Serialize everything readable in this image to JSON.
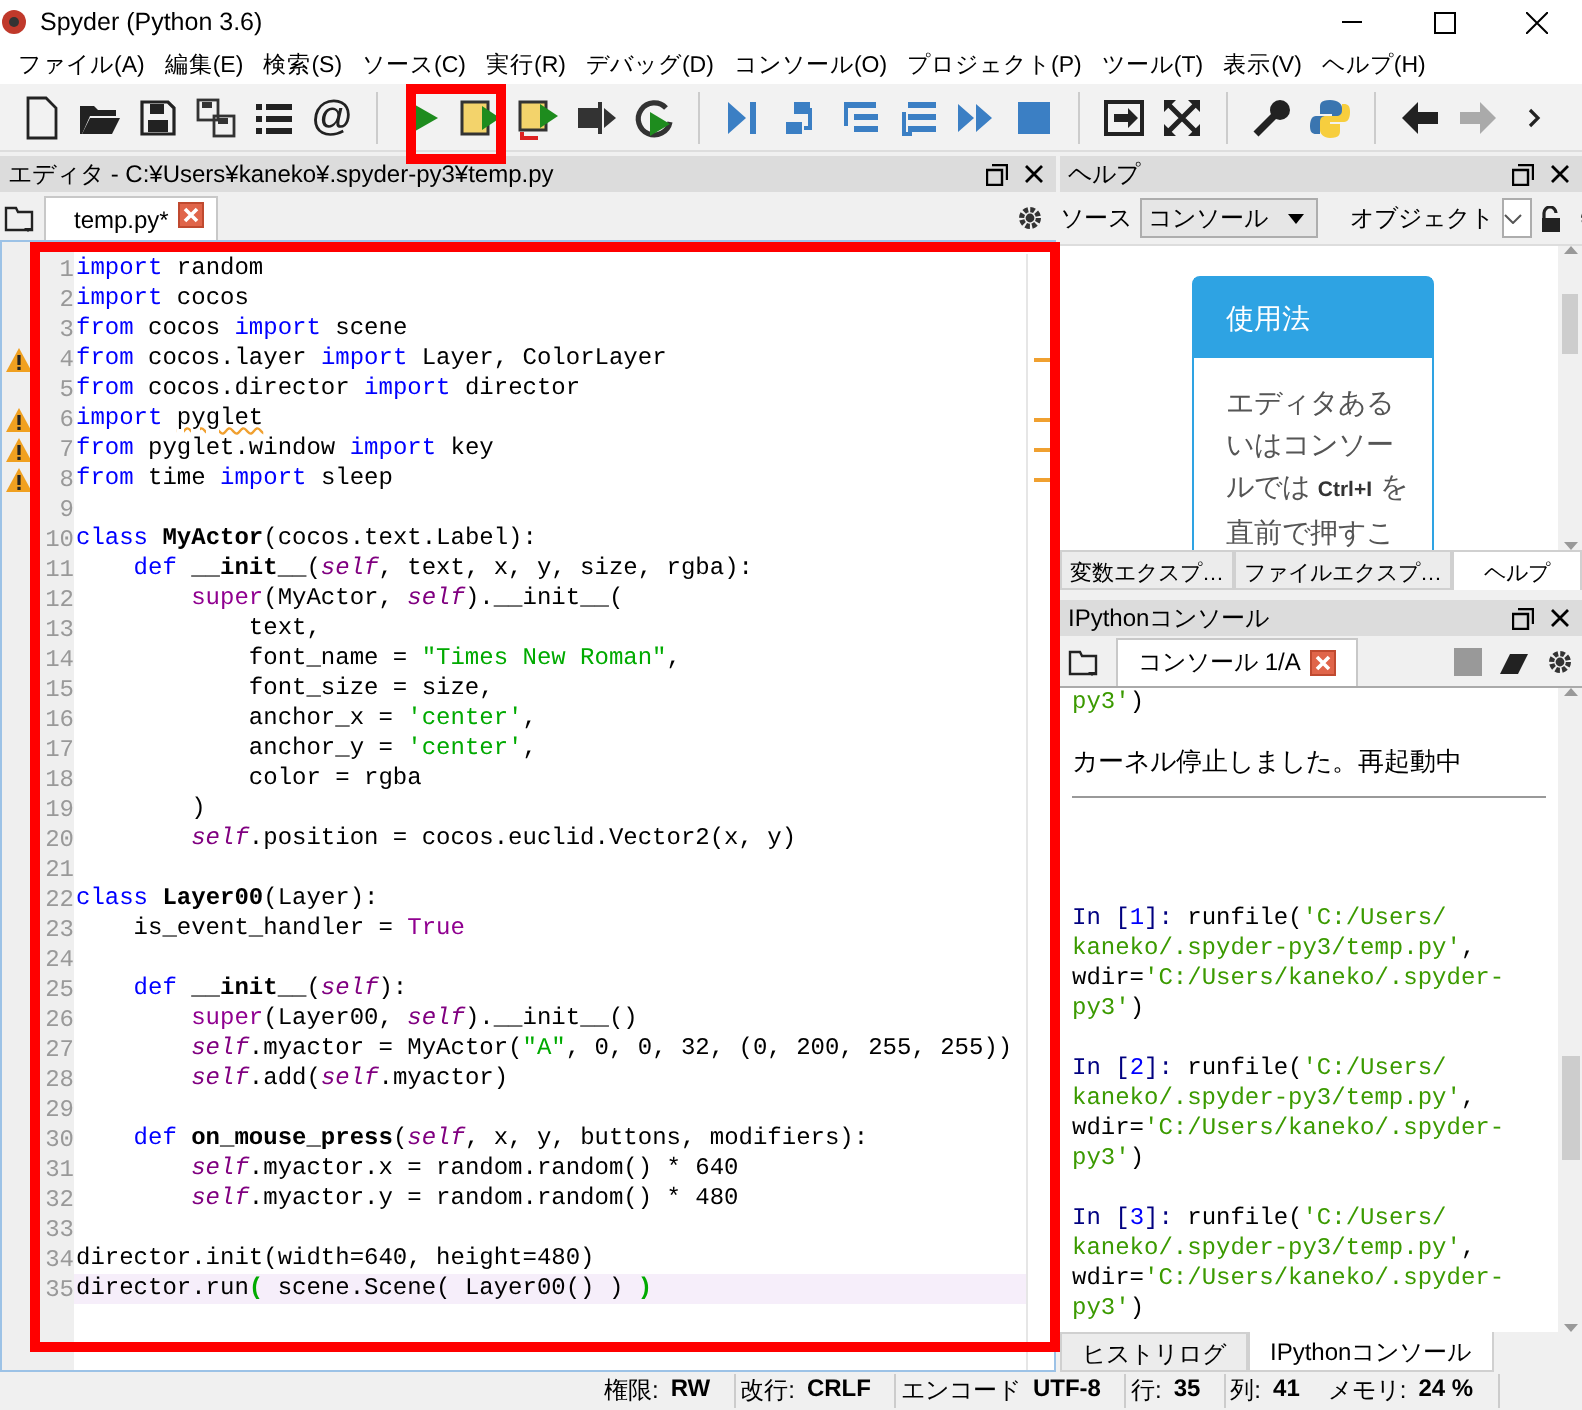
{
  "window": {
    "title": "Spyder (Python 3.6)"
  },
  "menu": [
    "ファイル(A)",
    "編集(E)",
    "検索(S)",
    "ソース(C)",
    "実行(R)",
    "デバッグ(D)",
    "コンソール(O)",
    "プロジェクト(P)",
    "ツール(T)",
    "表示(V)",
    "ヘルプ(H)"
  ],
  "toolbar": {
    "glyph": "@"
  },
  "editor": {
    "title": "エディタ - C:¥Users¥kaneko¥.spyder-py3¥temp.py",
    "tabs": [
      {
        "label": "temp.py*",
        "selected": true
      }
    ],
    "lines": [
      {
        "n": "1",
        "warning": false,
        "current": false,
        "tokens": [
          {
            "kind": "keyword",
            "text": "import "
          },
          {
            "kind": "plain",
            "text": "random"
          }
        ]
      },
      {
        "n": "2",
        "warning": false,
        "current": false,
        "tokens": [
          {
            "kind": "keyword",
            "text": "import "
          },
          {
            "kind": "plain",
            "text": "cocos"
          }
        ]
      },
      {
        "n": "3",
        "warning": false,
        "current": false,
        "tokens": [
          {
            "kind": "keyword",
            "text": "from "
          },
          {
            "kind": "plain",
            "text": "cocos "
          },
          {
            "kind": "keyword",
            "text": "import "
          },
          {
            "kind": "plain",
            "text": "scene"
          }
        ]
      },
      {
        "n": "4",
        "warning": true,
        "current": false,
        "tokens": [
          {
            "kind": "keyword",
            "text": "from "
          },
          {
            "kind": "plain",
            "text": "cocos.layer "
          },
          {
            "kind": "keyword",
            "text": "import "
          },
          {
            "kind": "plain",
            "text": "Layer, ColorLayer"
          }
        ]
      },
      {
        "n": "5",
        "warning": false,
        "current": false,
        "tokens": [
          {
            "kind": "keyword",
            "text": "from "
          },
          {
            "kind": "plain",
            "text": "cocos.director "
          },
          {
            "kind": "keyword",
            "text": "import "
          },
          {
            "kind": "plain",
            "text": "director"
          }
        ]
      },
      {
        "n": "6",
        "warning": true,
        "current": false,
        "tokens": [
          {
            "kind": "keyword",
            "text": "import "
          },
          {
            "kind": "warned",
            "text": "pyglet"
          }
        ]
      },
      {
        "n": "7",
        "warning": true,
        "current": false,
        "tokens": [
          {
            "kind": "keyword",
            "text": "from "
          },
          {
            "kind": "plain",
            "text": "pyglet.window "
          },
          {
            "kind": "keyword",
            "text": "import "
          },
          {
            "kind": "plain",
            "text": "key"
          }
        ]
      },
      {
        "n": "8",
        "warning": true,
        "current": false,
        "tokens": [
          {
            "kind": "keyword",
            "text": "from "
          },
          {
            "kind": "plain",
            "text": "time "
          },
          {
            "kind": "keyword",
            "text": "import "
          },
          {
            "kind": "plain",
            "text": "sleep"
          }
        ]
      },
      {
        "n": "9",
        "warning": false,
        "current": false
      },
      {
        "n": "10",
        "warning": false,
        "current": false,
        "tokens": [
          {
            "kind": "keyword",
            "text": "class "
          },
          {
            "kind": "definition",
            "text": "MyActor"
          },
          {
            "kind": "plain",
            "text": "(cocos.text.Label):"
          }
        ]
      },
      {
        "n": "11",
        "warning": false,
        "current": false,
        "tokens": [
          {
            "kind": "keyword",
            "text": "    def "
          },
          {
            "kind": "definition",
            "text": "__init__"
          },
          {
            "kind": "plain",
            "text": "("
          },
          {
            "kind": "self",
            "text": "self"
          },
          {
            "kind": "plain",
            "text": ", text, x, y, size, rgba):"
          }
        ]
      },
      {
        "n": "12",
        "warning": false,
        "current": false,
        "tokens": [
          {
            "kind": "builtin",
            "text": "        super"
          },
          {
            "kind": "plain",
            "text": "(MyActor, "
          },
          {
            "kind": "self",
            "text": "self"
          },
          {
            "kind": "plain",
            "text": ").__init__("
          }
        ]
      },
      {
        "n": "13",
        "warning": false,
        "current": false,
        "tokens": [
          {
            "kind": "plain",
            "text": "            text,"
          }
        ]
      },
      {
        "n": "14",
        "warning": false,
        "current": false,
        "tokens": [
          {
            "kind": "plain",
            "text": "            font_name = "
          },
          {
            "kind": "string",
            "text": "\"Times New Roman\""
          },
          {
            "kind": "plain",
            "text": ","
          }
        ]
      },
      {
        "n": "15",
        "warning": false,
        "current": false,
        "tokens": [
          {
            "kind": "plain",
            "text": "            font_size = size,"
          }
        ]
      },
      {
        "n": "16",
        "warning": false,
        "current": false,
        "tokens": [
          {
            "kind": "plain",
            "text": "            anchor_x = "
          },
          {
            "kind": "string",
            "text": "'center'"
          },
          {
            "kind": "plain",
            "text": ","
          }
        ]
      },
      {
        "n": "17",
        "warning": false,
        "current": false,
        "tokens": [
          {
            "kind": "plain",
            "text": "            anchor_y = "
          },
          {
            "kind": "string",
            "text": "'center'"
          },
          {
            "kind": "plain",
            "text": ","
          }
        ]
      },
      {
        "n": "18",
        "warning": false,
        "current": false,
        "tokens": [
          {
            "kind": "plain",
            "text": "            color = rgba"
          }
        ]
      },
      {
        "n": "19",
        "warning": false,
        "current": false,
        "tokens": [
          {
            "kind": "plain",
            "text": "        )"
          }
        ]
      },
      {
        "n": "20",
        "warning": false,
        "current": false,
        "tokens": [
          {
            "kind": "self",
            "text": "        self"
          },
          {
            "kind": "plain",
            "text": ".position = cocos.euclid.Vector2(x, y)"
          }
        ]
      },
      {
        "n": "21",
        "warning": false,
        "current": false
      },
      {
        "n": "22",
        "warning": false,
        "current": false,
        "tokens": [
          {
            "kind": "keyword",
            "text": "class "
          },
          {
            "kind": "definition",
            "text": "Layer00"
          },
          {
            "kind": "plain",
            "text": "(Layer):"
          }
        ]
      },
      {
        "n": "23",
        "warning": false,
        "current": false,
        "tokens": [
          {
            "kind": "plain",
            "text": "    is_event_handler = "
          },
          {
            "kind": "builtin",
            "text": "True"
          }
        ]
      },
      {
        "n": "24",
        "warning": false,
        "current": false
      },
      {
        "n": "25",
        "warning": false,
        "current": false,
        "tokens": [
          {
            "kind": "keyword",
            "text": "    def "
          },
          {
            "kind": "definition",
            "text": "__init__"
          },
          {
            "kind": "plain",
            "text": "("
          },
          {
            "kind": "self",
            "text": "self"
          },
          {
            "kind": "plain",
            "text": "):"
          }
        ]
      },
      {
        "n": "26",
        "warning": false,
        "current": false,
        "tokens": [
          {
            "kind": "builtin",
            "text": "        super"
          },
          {
            "kind": "plain",
            "text": "(Layer00, "
          },
          {
            "kind": "self",
            "text": "self"
          },
          {
            "kind": "plain",
            "text": ").__init__()"
          }
        ]
      },
      {
        "n": "27",
        "warning": false,
        "current": false,
        "tokens": [
          {
            "kind": "self",
            "text": "        self"
          },
          {
            "kind": "plain",
            "text": ".myactor = MyActor("
          },
          {
            "kind": "string",
            "text": "\"A\""
          },
          {
            "kind": "plain",
            "text": ", 0, 0, 32, (0, 200, 255, 255))"
          }
        ]
      },
      {
        "n": "28",
        "warning": false,
        "current": false,
        "tokens": [
          {
            "kind": "self",
            "text": "        self"
          },
          {
            "kind": "plain",
            "text": ".add("
          },
          {
            "kind": "self",
            "text": "self"
          },
          {
            "kind": "plain",
            "text": ".myactor)"
          }
        ]
      },
      {
        "n": "29",
        "warning": false,
        "current": false
      },
      {
        "n": "30",
        "warning": false,
        "current": false,
        "tokens": [
          {
            "kind": "keyword",
            "text": "    def "
          },
          {
            "kind": "definition",
            "text": "on_mouse_press"
          },
          {
            "kind": "plain",
            "text": "("
          },
          {
            "kind": "self",
            "text": "self"
          },
          {
            "kind": "plain",
            "text": ", x, y, buttons, modifiers):"
          }
        ]
      },
      {
        "n": "31",
        "warning": false,
        "current": false,
        "tokens": [
          {
            "kind": "self",
            "text": "        self"
          },
          {
            "kind": "plain",
            "text": ".myactor.x = random.random() * 640"
          }
        ]
      },
      {
        "n": "32",
        "warning": false,
        "current": false,
        "tokens": [
          {
            "kind": "self",
            "text": "        self"
          },
          {
            "kind": "plain",
            "text": ".myactor.y = random.random() * 480"
          }
        ]
      },
      {
        "n": "33",
        "warning": false,
        "current": false
      },
      {
        "n": "34",
        "warning": false,
        "current": false,
        "tokens": [
          {
            "kind": "plain",
            "text": "director.init(width=640, height=480)"
          }
        ]
      },
      {
        "n": "35",
        "warning": false,
        "current": true,
        "tokens": [
          {
            "kind": "plain",
            "text": "director.run"
          },
          {
            "kind": "bracket",
            "text": "("
          },
          {
            "kind": "plain",
            "text": " scene.Scene( Layer00() ) "
          },
          {
            "kind": "bracket",
            "text": ")"
          }
        ]
      }
    ]
  },
  "help": {
    "title": "ヘルプ",
    "source_label": "ソース",
    "source_value": "コンソール",
    "object_label": "オブジェクト",
    "card_title": "使用法",
    "card_text": "エディタあるいはコンソールでは **Ctrl+I** を直前で押すこ",
    "tabs": [
      {
        "label": "変数エクスプ…",
        "selected": false
      },
      {
        "label": "ファイルエクスプ…",
        "selected": false
      },
      {
        "label": "ヘルプ",
        "selected": true
      }
    ]
  },
  "console": {
    "title": "IPythonコンソール",
    "tabs": [
      {
        "label": "コンソール 1/A",
        "selected": true
      }
    ],
    "history": [
      {
        "kind": "code",
        "tokens": [
          {
            "kind": "string",
            "text": "py3'"
          },
          {
            "kind": "plain",
            "text": ")"
          }
        ]
      },
      {
        "kind": "message",
        "text": "カーネル停止しました。再起動中"
      }
    ],
    "inputs": [
      {
        "lines": [
          [
            {
              "kind": "prompt",
              "text": "In ["
            },
            {
              "kind": "count",
              "text": "1"
            },
            {
              "kind": "prompt",
              "text": "]: "
            },
            {
              "kind": "plain",
              "text": "runfile("
            },
            {
              "kind": "string",
              "text": "'C:/Users/"
            }
          ],
          [
            {
              "kind": "string",
              "text": "kaneko/.spyder-py3/temp.py'"
            },
            {
              "kind": "plain",
              "text": ","
            }
          ],
          [
            {
              "kind": "plain",
              "text": "wdir="
            },
            {
              "kind": "string",
              "text": "'C:/Users/kaneko/.spyder-"
            }
          ],
          [
            {
              "kind": "string",
              "text": "py3'"
            },
            {
              "kind": "plain",
              "text": ")"
            }
          ]
        ]
      },
      {
        "lines": [
          [
            {
              "kind": "prompt",
              "text": "In ["
            },
            {
              "kind": "count",
              "text": "2"
            },
            {
              "kind": "prompt",
              "text": "]: "
            },
            {
              "kind": "plain",
              "text": "runfile("
            },
            {
              "kind": "string",
              "text": "'C:/Users/"
            }
          ],
          [
            {
              "kind": "string",
              "text": "kaneko/.spyder-py3/temp.py'"
            },
            {
              "kind": "plain",
              "text": ","
            }
          ],
          [
            {
              "kind": "plain",
              "text": "wdir="
            },
            {
              "kind": "string",
              "text": "'C:/Users/kaneko/.spyder-"
            }
          ],
          [
            {
              "kind": "string",
              "text": "py3'"
            },
            {
              "kind": "plain",
              "text": ")"
            }
          ]
        ]
      },
      {
        "lines": [
          [
            {
              "kind": "prompt",
              "text": "In ["
            },
            {
              "kind": "count",
              "text": "3"
            },
            {
              "kind": "prompt",
              "text": "]: "
            },
            {
              "kind": "plain",
              "text": "runfile("
            },
            {
              "kind": "string",
              "text": "'C:/Users/"
            }
          ],
          [
            {
              "kind": "string",
              "text": "kaneko/.spyder-py3/temp.py'"
            },
            {
              "kind": "plain",
              "text": ","
            }
          ],
          [
            {
              "kind": "plain",
              "text": "wdir="
            },
            {
              "kind": "string",
              "text": "'C:/Users/kaneko/.spyder-"
            }
          ],
          [
            {
              "kind": "string",
              "text": "py3'"
            },
            {
              "kind": "plain",
              "text": ")"
            }
          ]
        ]
      }
    ],
    "bottom_tabs": [
      {
        "label": "ヒストリログ",
        "selected": false
      },
      {
        "label": "IPythonコンソール",
        "selected": true
      }
    ]
  },
  "status_bar": [
    {
      "label": "権限:",
      "value": "RW"
    },
    {
      "label": "改行:",
      "value": "CRLF"
    },
    {
      "label": "エンコード",
      "value": "UTF-8"
    },
    {
      "label": "行:",
      "value": "35"
    },
    {
      "label": "列:",
      "value": "41"
    },
    {
      "label": "メモリ:",
      "value": "24 %"
    }
  ]
}
